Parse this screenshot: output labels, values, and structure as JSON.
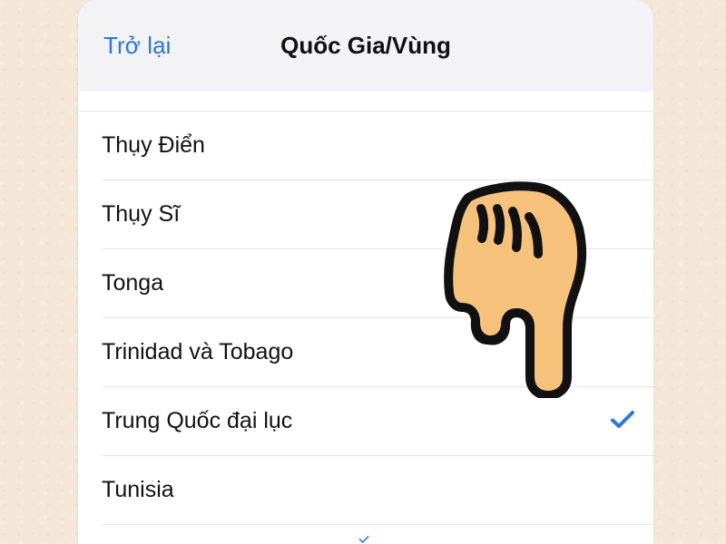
{
  "header": {
    "back_label": "Trở lại",
    "title": "Quốc Gia/Vùng"
  },
  "list": {
    "items": [
      {
        "label": "Thụy Điển",
        "selected": false
      },
      {
        "label": "Thụy Sĩ",
        "selected": false
      },
      {
        "label": "Tonga",
        "selected": false
      },
      {
        "label": "Trinidad và Tobago",
        "selected": false
      },
      {
        "label": "Trung Quốc đại lục",
        "selected": true
      },
      {
        "label": "Tunisia",
        "selected": false
      }
    ]
  },
  "icons": {
    "back": "back-link",
    "checkmark": "check-icon",
    "hand": "pointing-hand-icon"
  },
  "colors": {
    "accent": "#2b78d8",
    "page_background": "#f5e7d8",
    "surface": "#ffffff",
    "text": "#111111",
    "divider": "#e3e3e7",
    "hand_fill": "#f6c27b",
    "hand_outline": "#111111"
  }
}
